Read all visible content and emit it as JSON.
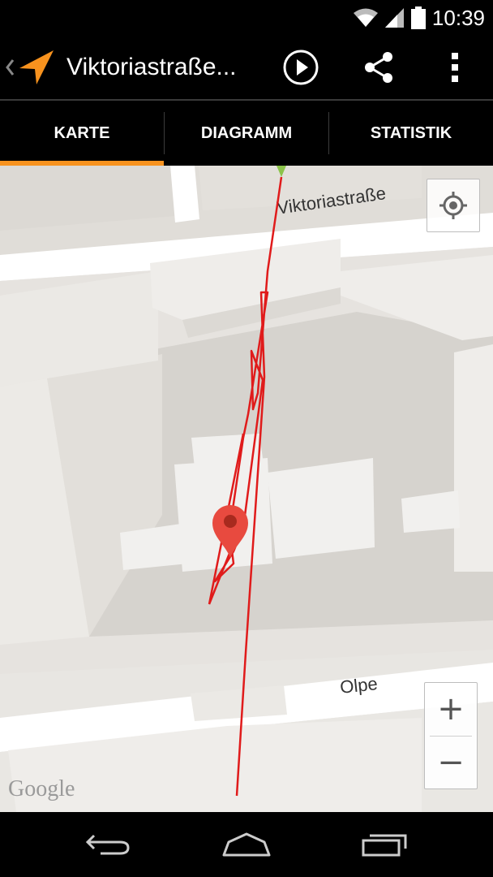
{
  "status_bar": {
    "time": "10:39",
    "icons": [
      "wifi-icon",
      "signal-icon",
      "battery-icon"
    ]
  },
  "action_bar": {
    "title": "Viktoriastraße...",
    "icons": [
      "back-chevron-icon",
      "app-arrow-icon",
      "play-icon",
      "share-icon",
      "overflow-menu-icon"
    ]
  },
  "tabs": [
    {
      "label": "KARTE",
      "selected": true
    },
    {
      "label": "DIAGRAMM",
      "selected": false
    },
    {
      "label": "STATISTIK",
      "selected": false
    }
  ],
  "map": {
    "street_labels": [
      "Viktoriastraße",
      "Olpe"
    ],
    "attribution": "Google",
    "zoom_in_label": "+",
    "zoom_out_label": "−",
    "track_color": "#e01b1b",
    "marker_color": "#e84a3f",
    "icons": [
      "my-location-icon",
      "map-marker-icon",
      "track-start-icon"
    ]
  },
  "colors": {
    "accent": "#f7921e",
    "status_bar": "#000000"
  },
  "nav_bar": {
    "icons": [
      "back-icon",
      "home-icon",
      "recents-icon"
    ]
  }
}
